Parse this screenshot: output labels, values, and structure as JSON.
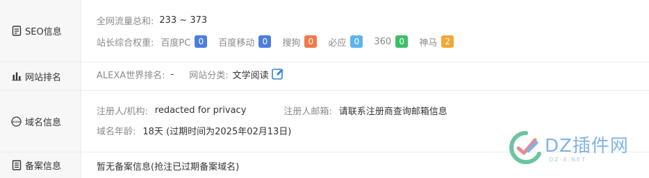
{
  "seo": {
    "label": "SEO信息",
    "traffic_label": "全网流量总和:",
    "traffic_value": "233 ~ 373",
    "weight_label": "站长综合权重:",
    "engines": [
      {
        "name": "百度PC",
        "value": "0",
        "color": "#4a7fe0"
      },
      {
        "name": "百度移动",
        "value": "0",
        "color": "#4a7fe0"
      },
      {
        "name": "搜狗",
        "value": "0",
        "color": "#f07a4a"
      },
      {
        "name": "必应",
        "value": "0",
        "color": "#5fb3ef"
      },
      {
        "name": "360",
        "value": "0",
        "color": "#3fbe6a"
      },
      {
        "name": "神马",
        "value": "2",
        "color": "#f2a73a"
      }
    ]
  },
  "rank": {
    "label": "网站排名",
    "alexa_label": "ALEXA世界排名:",
    "alexa_value": "-",
    "category_label": "网站分类:",
    "category_value": "文学阅读"
  },
  "domain": {
    "label": "域名信息",
    "registrant_label": "注册人/机构:",
    "registrant_value": "redacted for privacy",
    "email_label": "注册人邮箱:",
    "email_value": "请联系注册商查询邮箱信息",
    "age_label": "域名年龄:",
    "age_value": "18天 (过期时间为2025年02月13日)"
  },
  "icp": {
    "label": "备案信息",
    "value": "暂无备案信息(抢注已过期备案域名)"
  },
  "watermark": {
    "brand": "DZ插件网",
    "sub": "DZ-X.NET"
  }
}
